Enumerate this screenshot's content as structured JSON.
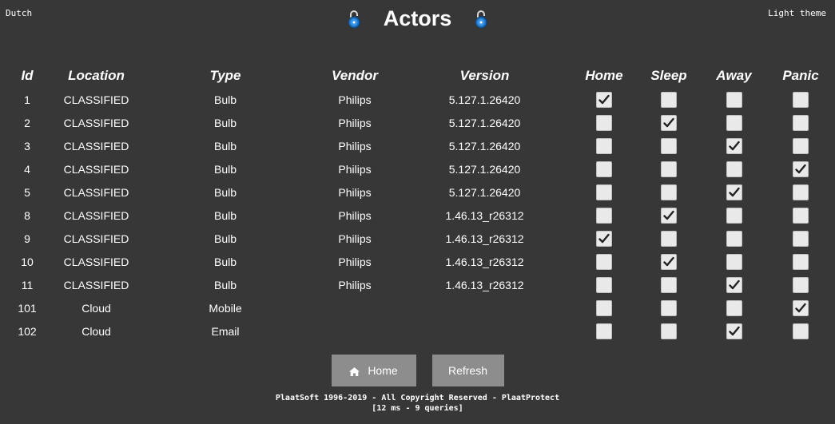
{
  "header": {
    "language_link": "Dutch",
    "theme_link": "Light theme",
    "title": "Actors",
    "left_icon": "lock-icon",
    "right_icon": "lock-icon"
  },
  "table": {
    "columns": [
      "Id",
      "Location",
      "Type",
      "Vendor",
      "Version",
      "Home",
      "Sleep",
      "Away",
      "Panic"
    ],
    "rows": [
      {
        "id": "1",
        "location": "CLASSIFIED",
        "type": "Bulb",
        "vendor": "Philips",
        "version": "5.127.1.26420",
        "home": true,
        "sleep": false,
        "away": false,
        "panic": false
      },
      {
        "id": "2",
        "location": "CLASSIFIED",
        "type": "Bulb",
        "vendor": "Philips",
        "version": "5.127.1.26420",
        "home": false,
        "sleep": true,
        "away": false,
        "panic": false
      },
      {
        "id": "3",
        "location": "CLASSIFIED",
        "type": "Bulb",
        "vendor": "Philips",
        "version": "5.127.1.26420",
        "home": false,
        "sleep": false,
        "away": true,
        "panic": false
      },
      {
        "id": "4",
        "location": "CLASSIFIED",
        "type": "Bulb",
        "vendor": "Philips",
        "version": "5.127.1.26420",
        "home": false,
        "sleep": false,
        "away": false,
        "panic": true
      },
      {
        "id": "5",
        "location": "CLASSIFIED",
        "type": "Bulb",
        "vendor": "Philips",
        "version": "5.127.1.26420",
        "home": false,
        "sleep": false,
        "away": true,
        "panic": false
      },
      {
        "id": "8",
        "location": "CLASSIFIED",
        "type": "Bulb",
        "vendor": "Philips",
        "version": "1.46.13_r26312",
        "home": false,
        "sleep": true,
        "away": false,
        "panic": false
      },
      {
        "id": "9",
        "location": "CLASSIFIED",
        "type": "Bulb",
        "vendor": "Philips",
        "version": "1.46.13_r26312",
        "home": true,
        "sleep": false,
        "away": false,
        "panic": false
      },
      {
        "id": "10",
        "location": "CLASSIFIED",
        "type": "Bulb",
        "vendor": "Philips",
        "version": "1.46.13_r26312",
        "home": false,
        "sleep": true,
        "away": false,
        "panic": false
      },
      {
        "id": "11",
        "location": "CLASSIFIED",
        "type": "Bulb",
        "vendor": "Philips",
        "version": "1.46.13_r26312",
        "home": false,
        "sleep": false,
        "away": true,
        "panic": false
      },
      {
        "id": "101",
        "location": "Cloud",
        "type": "Mobile",
        "vendor": "",
        "version": "",
        "home": false,
        "sleep": false,
        "away": false,
        "panic": true
      },
      {
        "id": "102",
        "location": "Cloud",
        "type": "Email",
        "vendor": "",
        "version": "",
        "home": false,
        "sleep": false,
        "away": true,
        "panic": false
      }
    ]
  },
  "buttons": {
    "home_label": "Home",
    "home_icon": "home-icon",
    "refresh_label": "Refresh"
  },
  "footer": {
    "copyright": "PlaatSoft 1996-2019 - All Copyright Reserved - PlaatProtect",
    "stats": "[12 ms - 9 queries]"
  },
  "colors": {
    "background": "#373737",
    "classified": "#e0222b",
    "button": "#8d8d8d",
    "lock_blue": "#1b6fc0"
  }
}
